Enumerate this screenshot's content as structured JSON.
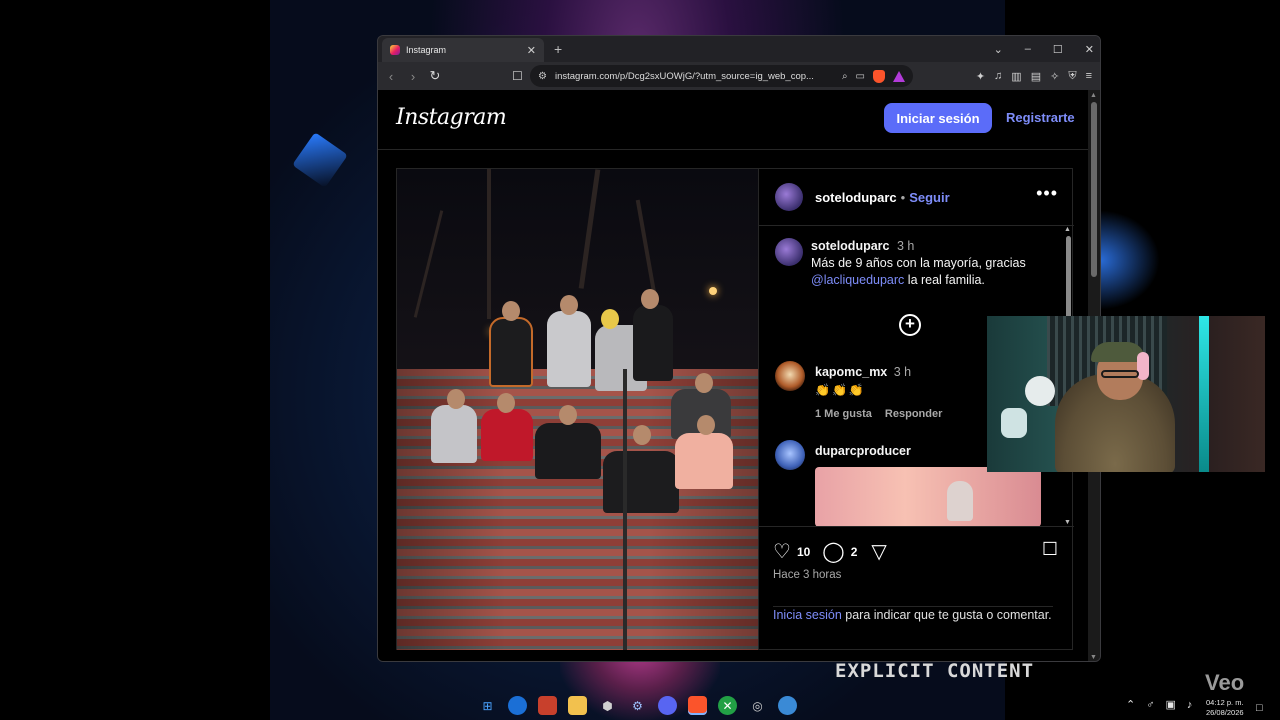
{
  "browser": {
    "tab_title": "Instagram",
    "tab_close": "✕",
    "new_tab": "+",
    "controls": {
      "dropdown": "⌄",
      "minimize": "–",
      "maximize": "☐",
      "close": "✕"
    },
    "url": "instagram.com/p/Dcg2sxUOWjG/?utm_source=ig_web_cop..."
  },
  "instagram": {
    "logo": "Instagram",
    "login_button": "Iniciar sesión",
    "signup_link": "Registrarte",
    "post": {
      "author": "soteloduparc",
      "separator": "•",
      "follow": "Seguir",
      "more": "•••",
      "caption": {
        "user": "soteloduparc",
        "time": "3 h",
        "text_line1": "Más de 9 años con la mayoría, gracias",
        "mention": "@lacliqueduparc",
        "text_line2": " la real familia."
      },
      "plus_icon": "+",
      "comments": [
        {
          "user": "kapomc_mx",
          "time": "3 h",
          "text": "👏👏👏",
          "likes": "1 Me gusta",
          "reply": "Responder"
        },
        {
          "user": "duparcproducer",
          "time": "",
          "text": "",
          "likes": "",
          "reply": ""
        }
      ],
      "likes_count": "10",
      "comments_count": "2",
      "time_ago": "Hace 3 horas",
      "login_prompt_link": "Inicia sesión",
      "login_prompt_rest": " para indicar que te gusta o comentar."
    }
  },
  "overlay": {
    "explicit_label": "EXPLICIT CONTENT",
    "watermark": "Veo"
  },
  "taskbar": {
    "time": "04:12 p. m.",
    "date": "26/08/2026"
  },
  "colors": {
    "accent_blue": "#5b6cf9",
    "link_blue": "#7e8df9",
    "page_bg": "#000000"
  }
}
